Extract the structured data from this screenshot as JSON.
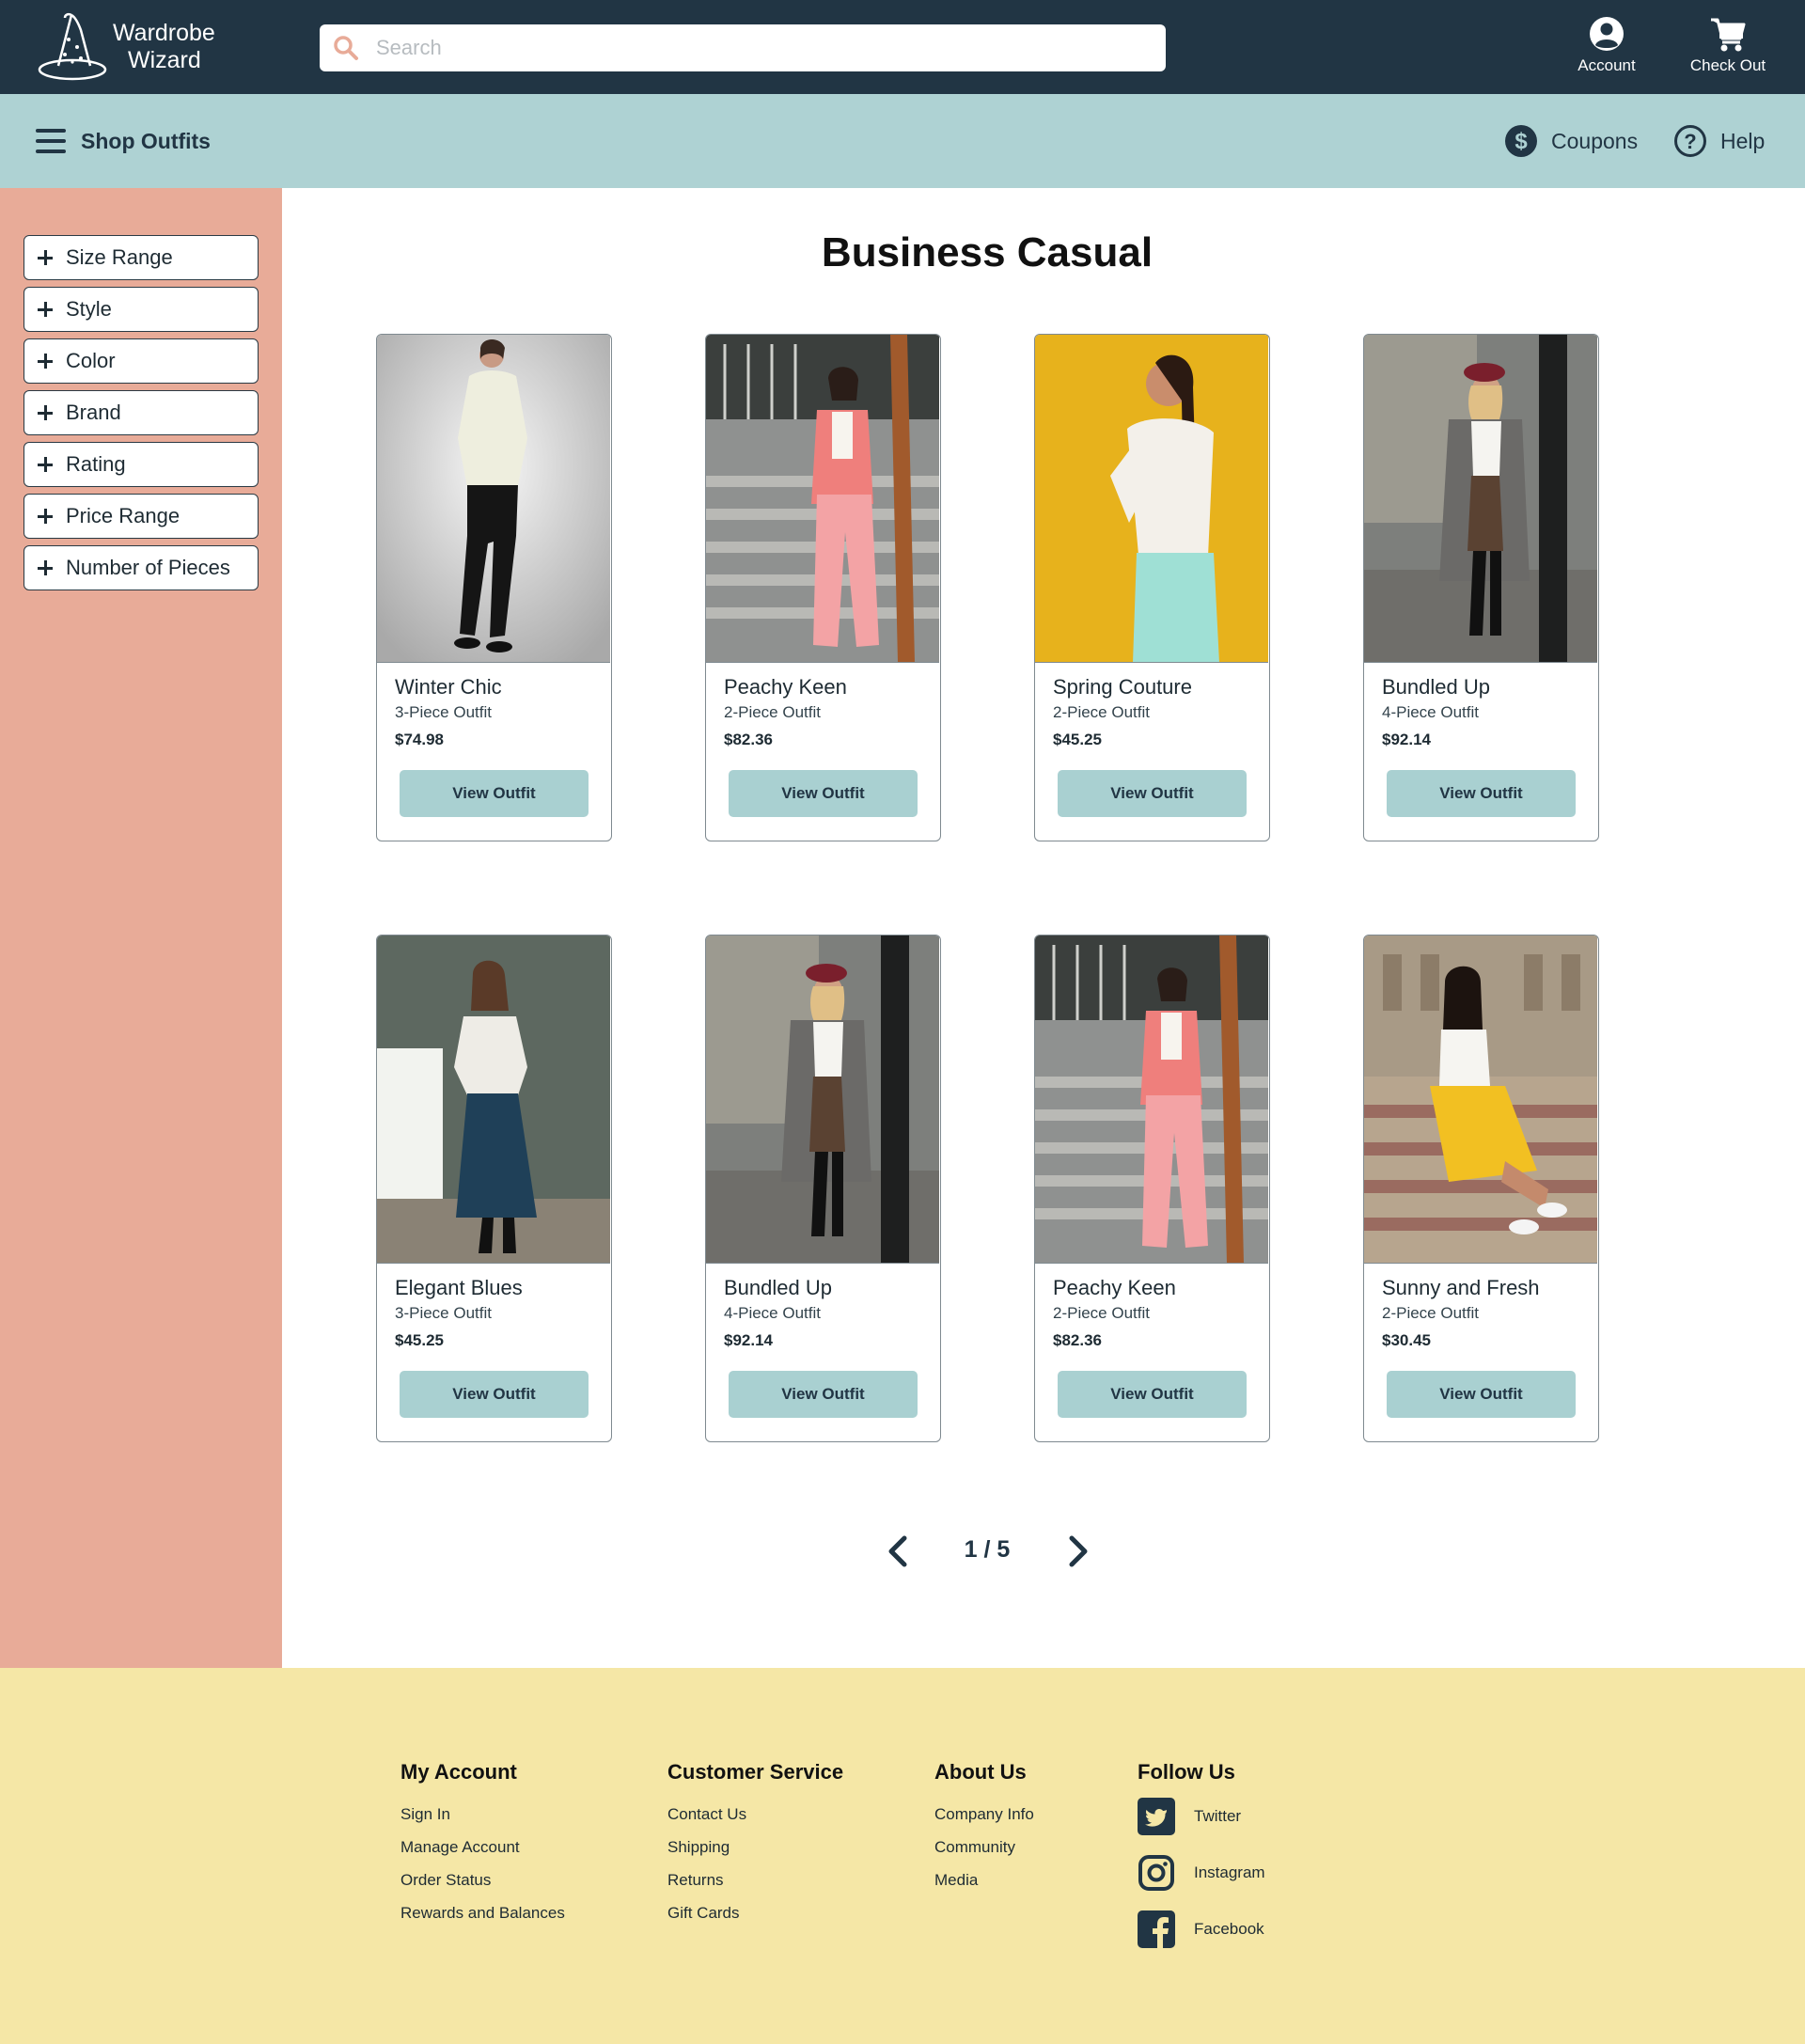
{
  "brand": {
    "line1": "Wardrobe",
    "line2": "Wizard"
  },
  "search": {
    "placeholder": "Search",
    "value": ""
  },
  "header": {
    "account_label": "Account",
    "checkout_label": "Check Out"
  },
  "nav": {
    "menu_label": "Shop Outfits",
    "coupons_label": "Coupons",
    "help_label": "Help"
  },
  "filters": [
    "Size Range",
    "Style",
    "Color",
    "Brand",
    "Rating",
    "Price Range",
    "Number of Pieces"
  ],
  "page": {
    "title": "Business Casual"
  },
  "products": [
    {
      "name": "Winter Chic",
      "pieces": "3-Piece Outfit",
      "price": "$74.98",
      "button": "View Outfit"
    },
    {
      "name": "Peachy Keen",
      "pieces": "2-Piece Outfit",
      "price": "$82.36",
      "button": "View Outfit"
    },
    {
      "name": "Spring Couture",
      "pieces": "2-Piece Outfit",
      "price": "$45.25",
      "button": "View Outfit"
    },
    {
      "name": "Bundled Up",
      "pieces": "4-Piece Outfit",
      "price": "$92.14",
      "button": "View Outfit"
    },
    {
      "name": "Elegant Blues",
      "pieces": "3-Piece Outfit",
      "price": "$45.25",
      "button": "View Outfit"
    },
    {
      "name": "Bundled Up",
      "pieces": "4-Piece Outfit",
      "price": "$92.14",
      "button": "View Outfit"
    },
    {
      "name": "Peachy Keen",
      "pieces": "2-Piece Outfit",
      "price": "$82.36",
      "button": "View Outfit"
    },
    {
      "name": "Sunny and Fresh",
      "pieces": "2-Piece Outfit",
      "price": "$30.45",
      "button": "View Outfit"
    }
  ],
  "pagination": {
    "label": "1 / 5",
    "current": 1,
    "total": 5
  },
  "footer": {
    "my_account": {
      "title": "My Account",
      "links": [
        "Sign In",
        "Manage Account",
        "Order Status",
        "Rewards and Balances"
      ]
    },
    "customer_service": {
      "title": "Customer Service",
      "links": [
        "Contact Us",
        "Shipping",
        "Returns",
        "Gift Cards"
      ]
    },
    "about_us": {
      "title": "About Us",
      "links": [
        "Company Info",
        "Community",
        "Media"
      ]
    },
    "follow_us": {
      "title": "Follow Us",
      "links": [
        "Twitter",
        "Instagram",
        "Facebook"
      ]
    }
  },
  "icons": {
    "logo": "wizard-hat-icon",
    "search": "search-icon",
    "account": "user-circle-icon",
    "checkout": "shopping-cart-icon",
    "menu": "hamburger-menu-icon",
    "coupons": "dollar-circle-icon",
    "help": "question-circle-icon",
    "filter": "plus-icon",
    "prev": "chevron-left-icon",
    "next": "chevron-right-icon",
    "twitter": "twitter-icon",
    "instagram": "instagram-icon",
    "facebook": "facebook-icon"
  },
  "colors": {
    "header_bg": "#213544",
    "nav_bg": "#aed2d3",
    "sidebar_bg": "#e8ab98",
    "footer_bg": "#f5e7a6",
    "button_bg": "#a9d0d1",
    "search_icon": "#e8ab98"
  }
}
